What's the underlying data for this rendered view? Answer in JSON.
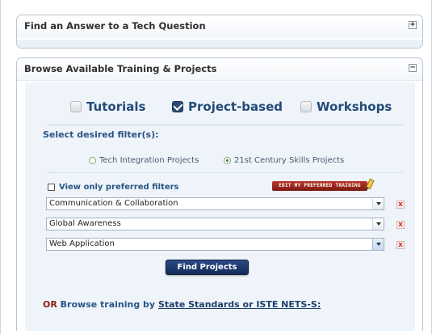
{
  "panel_tech": {
    "title": "Find an Answer to a Tech Question",
    "toggle": "+"
  },
  "panel_browse": {
    "title": "Browse Available Training & Projects",
    "toggle": "−",
    "types": [
      {
        "label": "Tutorials",
        "checked": false
      },
      {
        "label": "Project-based",
        "checked": true
      },
      {
        "label": "Workshops",
        "checked": false
      }
    ],
    "filter_title": "Select desired filter(s):",
    "radios": [
      {
        "label": "Tech Integration Projects",
        "selected": false
      },
      {
        "label": "21st Century Skills Projects",
        "selected": true
      }
    ],
    "preferred_label": "View only preferred filters",
    "edit_badge": "EDIT MY PREFERRED TRAINING",
    "selects": [
      {
        "value": "Communication & Collaboration"
      },
      {
        "value": "Global Awareness"
      },
      {
        "value": "Web Application"
      }
    ],
    "remove_glyph": "x",
    "find_button": "Find Projects",
    "or_text": "OR",
    "browse_text": "Browse training by",
    "standards_link": "State Standards or ISTE NETS-S:"
  },
  "colors": {
    "heading": "#244b78",
    "button": "#1d3768",
    "or_accent": "#8a1b15",
    "panel_fill": "#eef4fa"
  }
}
